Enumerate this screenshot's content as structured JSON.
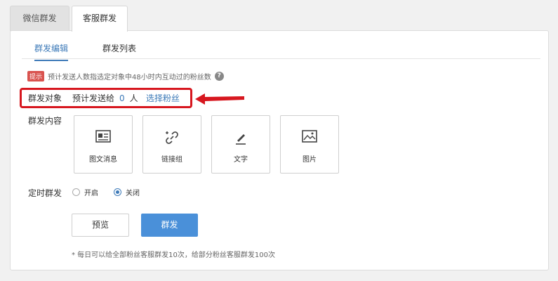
{
  "top_tabs": [
    {
      "label": "微信群发",
      "active": false
    },
    {
      "label": "客服群发",
      "active": true
    }
  ],
  "sub_tabs": [
    {
      "label": "群发编辑",
      "active": true
    },
    {
      "label": "群发列表",
      "active": false
    }
  ],
  "tip": {
    "badge": "提示",
    "text": "预计发送人数指选定对象中48小时内互动过的粉丝数",
    "help_icon": "question-circle-icon"
  },
  "target": {
    "label": "群发对象",
    "estimate_prefix": "预计发送给",
    "count": "0",
    "unit": "人",
    "select_link": "选择粉丝"
  },
  "content": {
    "label": "群发内容",
    "cards": [
      {
        "label": "图文消息",
        "icon": "news-icon"
      },
      {
        "label": "链接组",
        "icon": "link-icon"
      },
      {
        "label": "文字",
        "icon": "pencil-icon"
      },
      {
        "label": "图片",
        "icon": "image-icon"
      }
    ]
  },
  "timer": {
    "label": "定时群发",
    "options": [
      {
        "label": "开启",
        "checked": false
      },
      {
        "label": "关闭",
        "checked": true
      }
    ]
  },
  "buttons": {
    "preview": "预览",
    "send": "群发"
  },
  "footnote": "* 每日可以给全部粉丝客服群发10次，给部分粉丝客服群发100次",
  "colors": {
    "accent": "#3d7ab8",
    "primary_button": "#4a90d9",
    "highlight": "#d7171f"
  }
}
